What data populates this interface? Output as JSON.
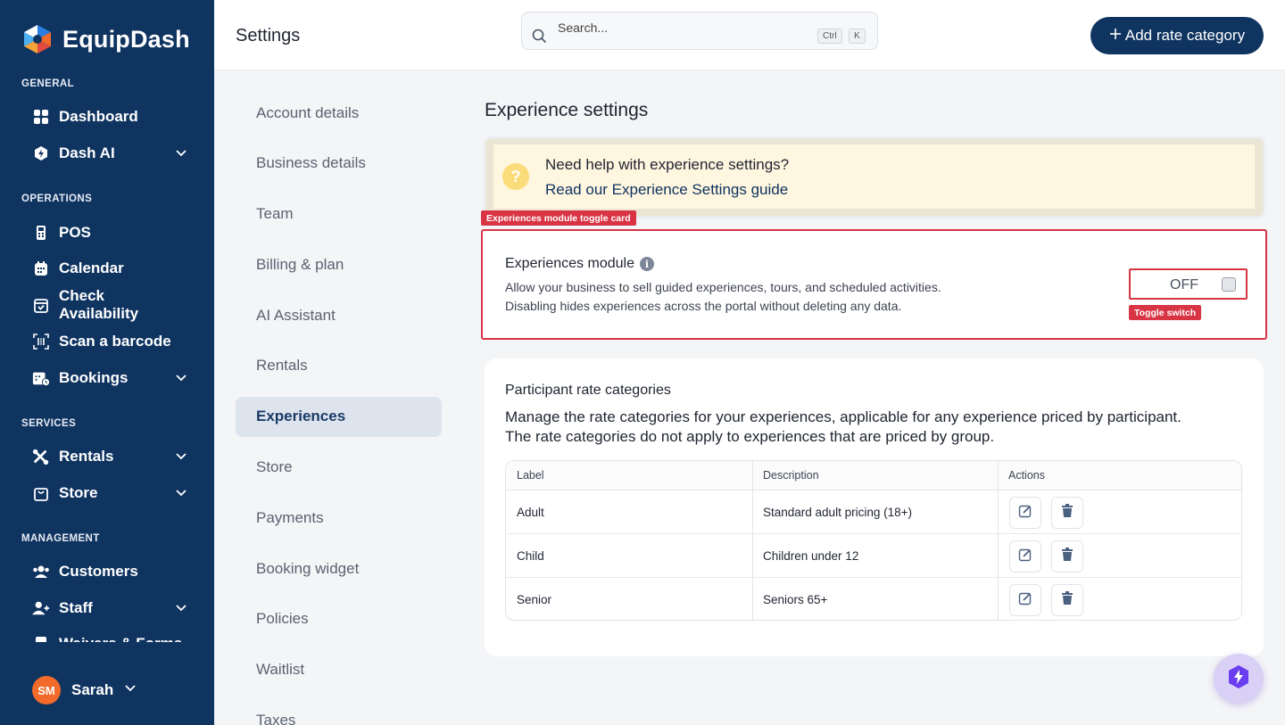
{
  "brand": {
    "name": "EquipDash"
  },
  "sidebar": {
    "sections": [
      {
        "label": "GENERAL"
      },
      {
        "label": "OPERATIONS"
      },
      {
        "label": "SERVICES"
      },
      {
        "label": "MANAGEMENT"
      }
    ],
    "items": [
      {
        "label": "Dashboard",
        "icon": "dashboard-grid-icon"
      },
      {
        "label": "Dash AI",
        "icon": "dash-ai-icon",
        "expandable": true
      },
      {
        "label": "POS",
        "icon": "pos-terminal-icon"
      },
      {
        "label": "Calendar",
        "icon": "calendar-icon"
      },
      {
        "label": "Check Availability",
        "icon": "calendar-check-icon"
      },
      {
        "label": "Scan a barcode",
        "icon": "barcode-scan-icon"
      },
      {
        "label": "Bookings",
        "icon": "bookings-icon",
        "expandable": true
      },
      {
        "label": "Rentals",
        "icon": "rentals-tools-icon",
        "expandable": true
      },
      {
        "label": "Store",
        "icon": "store-bag-icon",
        "expandable": true
      },
      {
        "label": "Customers",
        "icon": "customers-icon"
      },
      {
        "label": "Staff",
        "icon": "staff-icon",
        "expandable": true
      },
      {
        "label": "Waivers & Forms",
        "icon": "waivers-icon"
      }
    ],
    "user": {
      "initials": "SM",
      "name": "Sarah"
    }
  },
  "topbar": {
    "title": "Settings",
    "search": {
      "placeholder": "Search...",
      "kbd": [
        "Ctrl",
        "K"
      ]
    },
    "add_button": "Add rate category"
  },
  "settings_nav": {
    "items": [
      "Account details",
      "Business details",
      "Team",
      "Billing & plan",
      "AI Assistant",
      "Rentals",
      "Experiences",
      "Store",
      "Payments",
      "Booking widget",
      "Policies",
      "Waitlist",
      "Taxes"
    ],
    "active": "Experiences"
  },
  "main": {
    "title": "Experience settings",
    "help": {
      "question": "Need help with experience settings?",
      "link": "Read our Experience Settings guide"
    },
    "annotations": {
      "card_tag": "Experiences module toggle card",
      "toggle_tag": "Toggle switch"
    },
    "module": {
      "title": "Experiences module",
      "desc_line1": "Allow your business to sell guided experiences, tours, and scheduled activities.",
      "desc_line2": "Disabling hides experiences across the portal without deleting any data.",
      "toggle_label": "OFF"
    },
    "rates": {
      "title": "Participant rate categories",
      "desc_line1": "Manage the rate categories for your experiences, applicable for any experience priced by participant.",
      "desc_line2": "The rate categories do not apply to experiences that are priced by group.",
      "columns": [
        "Label",
        "Description",
        "Actions"
      ],
      "rows": [
        {
          "label": "Adult",
          "description": "Standard adult pricing (18+)"
        },
        {
          "label": "Child",
          "description": "Children under 12"
        },
        {
          "label": "Senior",
          "description": "Seniors 65+"
        }
      ]
    }
  },
  "colors": {
    "sidebar": "#0f3460",
    "accent": "#0f3460",
    "annotation": "#d83444",
    "avatar": "#f26b2a"
  }
}
